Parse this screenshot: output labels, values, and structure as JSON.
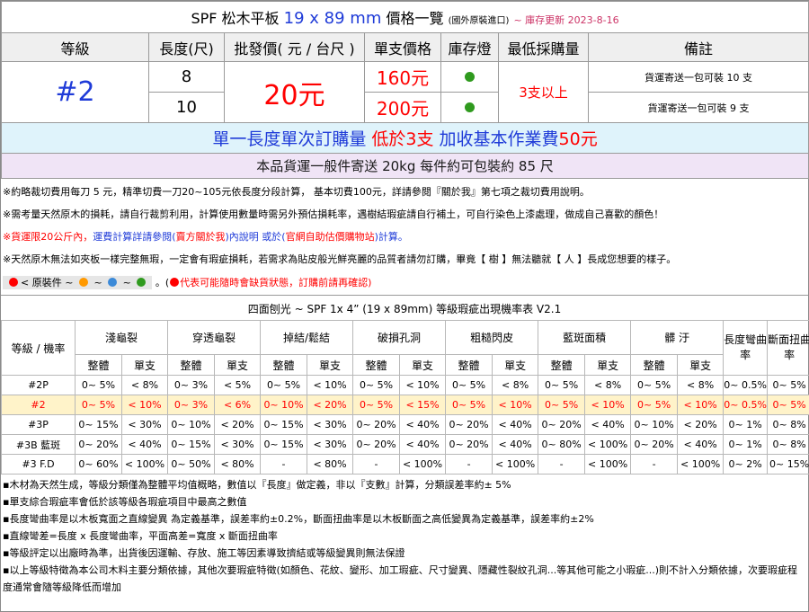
{
  "header": {
    "title": "SPF 松木平板",
    "size": "19 x 89 mm",
    "title_suffix": "價格一覽",
    "origin_note": "(國外原裝進口)",
    "update": "~ 庫存更新 2023-8-16"
  },
  "price_table": {
    "headers": [
      "等級",
      "長度(尺)",
      "批發價( 元 / 台尺 )",
      "單支價格",
      "庫存燈",
      "最低採購量",
      "備註"
    ],
    "grade": "#2",
    "wholesale_price": "20元",
    "min_order": "3支以上",
    "rows": [
      {
        "length": "8",
        "unit_price": "160元",
        "stock": "in-stock",
        "remark": "貨運寄送一包可裝 10 支"
      },
      {
        "length": "10",
        "unit_price": "200元",
        "stock": "in-stock",
        "remark": "貨運寄送一包可裝 9 支"
      }
    ],
    "stock_color": "#2f9a1e"
  },
  "order_notice": {
    "text_a": "單一長度單次訂購量 ",
    "text_b": "低於3支",
    "text_c": " 加收基本作業費",
    "text_d": "50元"
  },
  "shipping_notice": "本品貨運一般件寄送 20kg 每件約可包裝約 85 尺",
  "notes": {
    "n1": "※約略裁切費用每刀 5 元，精準切費一刀20~105元依長度分段計算， 基本切費100元，詳請參閱『關於我』第七項之裁切費用說明。",
    "n2": "※需考量天然原木的損耗，請自行裁剪利用，計算使用數量時需另外預估損耗率，遇樹結瑕疵請自行補土，可自行染色上漆處理，做成自己喜歡的顏色！",
    "n3_a": "※貨運限20公斤內，",
    "n3_b": "運費計算詳請參閱(",
    "n3_c": "賣方關於我",
    "n3_d": ")內說明 或於(",
    "n3_e": "官網自助估價購物站",
    "n3_f": ")計算。",
    "n4": "※天然原木無法如夾板一樣完整無瑕，一定會有瑕疵損耗，若需求為貼皮般光鮮亮麗的品質者請勿訂購，畢竟【 樹 】無法聽就【 人 】長成您想要的樣子。",
    "legend_label": "< 原裝件",
    "legend_sep": "~",
    "legend_after": "。(",
    "legend_warning": "代表可能隨時會缺貨狀態，訂購前請再確認)",
    "legend_colors": [
      "#ff0000",
      "#ff9900",
      "#3c8ad8",
      "#2f9a1e"
    ]
  },
  "defect_table": {
    "title": "四面刨光 ~ SPF 1x 4”  (19 x 89mm) 等級瑕疵出現機率表 V2.1",
    "grade_header": "等級 / 機率",
    "groups": [
      "淺龜裂",
      "穿透龜裂",
      "掉結/鬆結",
      "破損孔洞",
      "粗糙閃皮",
      "藍斑面積",
      "髒 汙"
    ],
    "bow_header": "長度彎曲率",
    "twist_header": "斷面扭曲率",
    "sub_whole": "整體",
    "sub_piece": "單支",
    "rows": [
      {
        "grade": "#2P",
        "cells": [
          "0~ 5%",
          "< 8%",
          "0~ 3%",
          "< 5%",
          "0~ 5%",
          "< 10%",
          "0~ 5%",
          "< 10%",
          "0~ 5%",
          "< 8%",
          "0~ 5%",
          "< 8%",
          "0~ 5%",
          "< 8%",
          "0~ 0.5%",
          "0~ 5%"
        ]
      },
      {
        "grade": "#2",
        "cells": [
          "0~ 5%",
          "< 10%",
          "0~ 3%",
          "< 6%",
          "0~ 10%",
          "< 20%",
          "0~ 5%",
          "< 15%",
          "0~ 5%",
          "< 10%",
          "0~ 5%",
          "< 10%",
          "0~ 5%",
          "< 10%",
          "0~ 0.5%",
          "0~ 5%"
        ]
      },
      {
        "grade": "#3P",
        "cells": [
          "0~ 15%",
          "< 30%",
          "0~ 10%",
          "< 20%",
          "0~ 15%",
          "< 30%",
          "0~ 20%",
          "< 40%",
          "0~ 20%",
          "< 40%",
          "0~ 20%",
          "< 40%",
          "0~ 10%",
          "< 20%",
          "0~ 1%",
          "0~ 8%"
        ]
      },
      {
        "grade": "#3B 藍斑",
        "cells": [
          "0~ 20%",
          "< 40%",
          "0~ 15%",
          "< 30%",
          "0~ 15%",
          "< 30%",
          "0~ 20%",
          "< 40%",
          "0~ 20%",
          "< 40%",
          "0~ 80%",
          "< 100%",
          "0~ 20%",
          "< 40%",
          "0~ 1%",
          "0~ 8%"
        ]
      },
      {
        "grade": "#3 F.D",
        "cells": [
          "0~ 60%",
          "< 100%",
          "0~ 50%",
          "< 80%",
          "-",
          "< 80%",
          "-",
          "< 100%",
          "-",
          "< 100%",
          "-",
          "< 100%",
          "-",
          "< 100%",
          "0~ 2%",
          "0~ 15%"
        ]
      }
    ],
    "highlight_row": "#2"
  },
  "footnotes": [
    "▪木材為天然生成，等級分類僅為整體平均值概略，數值以『長度』做定義，非以『支數』計算，分類誤差率約± 5%",
    "▪單支綜合瑕疵率會低於該等級各瑕疵項目中最高之數值",
    "▪長度彎曲率是以木板寬面之直線變異 為定義基準，誤差率約±0.2%，斷面扭曲率是以木板斷面之高低變異為定義基準，誤差率約±2%",
    "▪直線彎差=長度 x 長度彎曲率，平面高差=寬度 x 斷面扭曲率",
    "▪等級評定以出廠時為準，出貨後因運輸、存放、施工等因素導致擠結或等級變異則無法保證",
    "▪以上等級特徵為本公司木料主要分類依據，其他次要瑕疵特徵(如顏色、花紋、變形、加工瑕疵、尺寸變異、隱藏性裂紋孔洞...等其他可能之小瑕疵...)則不計入分類依據，次要瑕疵程度通常會隨等級降低而增加"
  ]
}
